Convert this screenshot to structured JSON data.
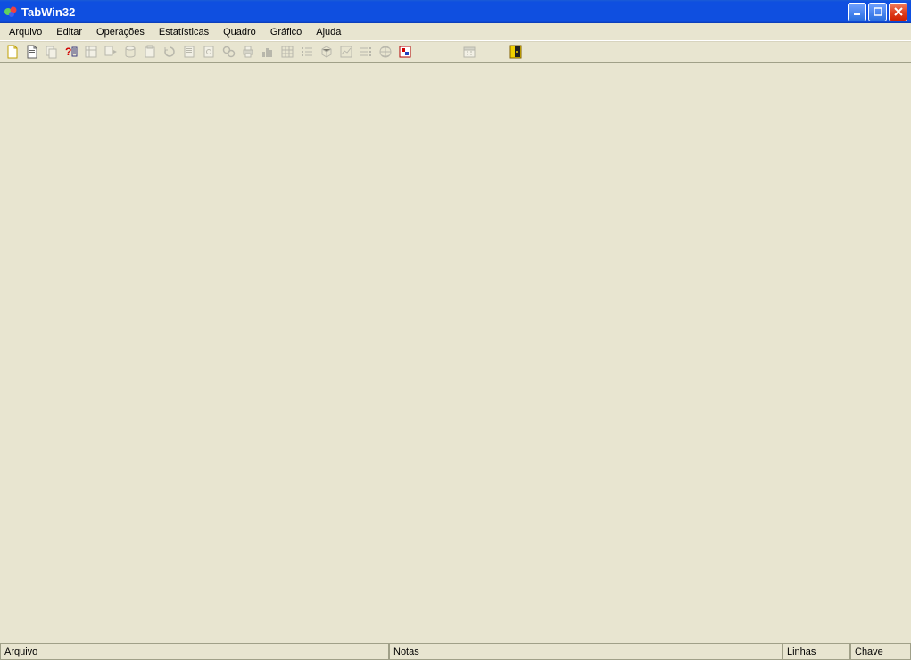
{
  "window": {
    "title": "TabWin32"
  },
  "menu": {
    "arquivo": "Arquivo",
    "editar": "Editar",
    "operacoes": "Operações",
    "estatisticas": "Estatísticas",
    "quadro": "Quadro",
    "grafico": "Gráfico",
    "ajuda": "Ajuda"
  },
  "statusbar": {
    "arquivo": "Arquivo",
    "notas": "Notas",
    "linhas": "Linhas",
    "chave": "Chave"
  }
}
